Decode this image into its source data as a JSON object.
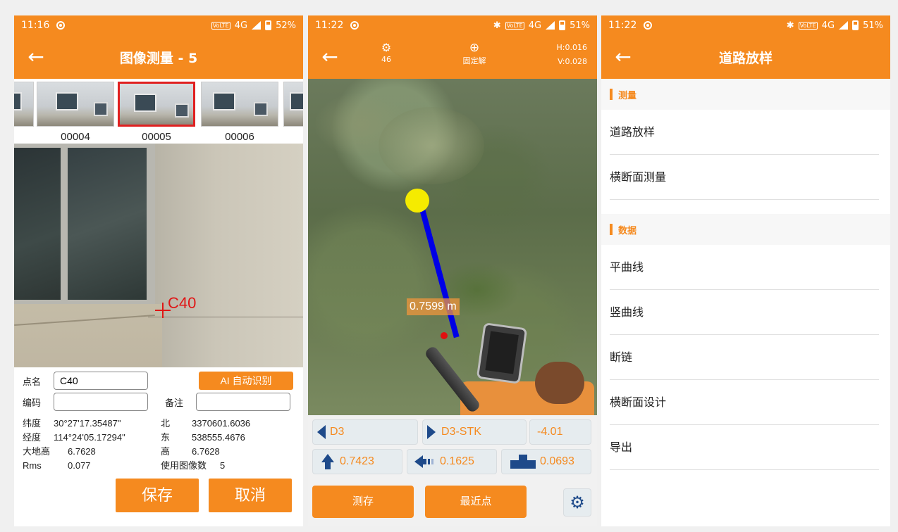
{
  "screen1": {
    "status": {
      "time": "11:16",
      "network": "4G",
      "battery": "52%"
    },
    "title": "图像测量 - 5",
    "thumbnails": [
      "00004",
      "00005",
      "00006"
    ],
    "photo_point_label": "C40",
    "form": {
      "name_label": "点名",
      "name_value": "C40",
      "code_label": "编码",
      "code_value": "",
      "note_label": "备注",
      "note_value": "",
      "ai_button": "AI 自动识别"
    },
    "info": [
      [
        "纬度",
        "30°27'17.35487\"",
        "北",
        "3370601.6036"
      ],
      [
        "经度",
        "114°24'05.17294\"",
        "东",
        "538555.4676"
      ],
      [
        "大地高",
        "6.7628",
        "高",
        "6.7628"
      ],
      [
        "Rms",
        "0.077",
        "使用图像数",
        "5"
      ]
    ],
    "save_button": "保存",
    "cancel_button": "取消"
  },
  "screen2": {
    "status": {
      "time": "11:22",
      "network": "4G",
      "battery": "51%"
    },
    "satellites": "46",
    "fix_status": "固定解",
    "h_precision": "H:0.016",
    "v_precision": "V:0.028",
    "distance_label": "0.7599 m",
    "prev_point": "D3",
    "next_point": "D3-STK",
    "offset": "-4.01",
    "north": "0.7423",
    "west": "0.1625",
    "fill": "0.0693",
    "measure_button": "测存",
    "nearest_button": "最近点"
  },
  "screen3": {
    "status": {
      "time": "11:22",
      "network": "4G",
      "battery": "51%"
    },
    "title": "道路放样",
    "sections": [
      {
        "title": "测量",
        "items": [
          "道路放样",
          "横断面测量"
        ]
      },
      {
        "title": "数据",
        "items": [
          "平曲线",
          "竖曲线",
          "断链",
          "横断面设计",
          "导出"
        ]
      }
    ]
  },
  "colors": {
    "accent": "#f58a1f",
    "icon_blue": "#1e4a8a",
    "marker_red": "#e01515"
  }
}
